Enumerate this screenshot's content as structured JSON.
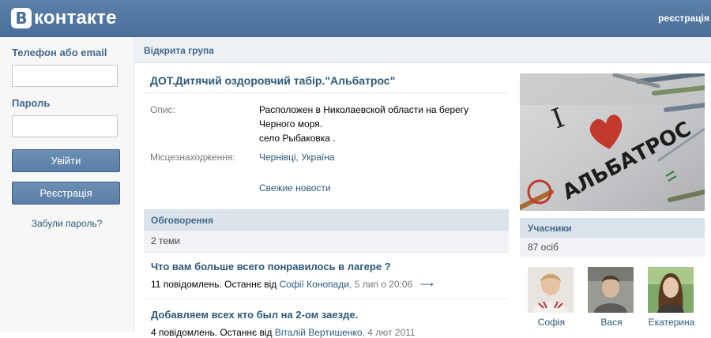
{
  "header": {
    "logo_letter": "B",
    "logo_text": "контакте",
    "register_link": "реєстрація"
  },
  "login": {
    "phone_label": "Телефон або email",
    "password_label": "Пароль",
    "login_button": "Увійти",
    "register_button": "Реєстрація",
    "forgot_link": "Забули пароль?"
  },
  "group": {
    "type_bar": "Відкрита група",
    "title": "ДОТ.Дитячий оздоровчий табір.\"Альбатрос\"",
    "description_label": "Опис:",
    "description_lines": [
      "Расположен в Николаевской области на берегу",
      "Черного моря.",
      "село Рыбаковка ."
    ],
    "location_label": "Місцезнаходження:",
    "location_value": "Чернівці, Україна",
    "news_link": "Свежие новости"
  },
  "discussions": {
    "header": "Обговорення",
    "count": "2 теми",
    "topics": [
      {
        "title": "Что вам больше всего понравилось в лагере ?",
        "meta_prefix": "11 повідомлень. Останнє від",
        "author": "Софії Конопади",
        "date": ", 5 лип о 20:06",
        "arrow": "⟶"
      },
      {
        "title": "Добавляем всех кто был на 2-ом заезде.",
        "meta_prefix": "4 повідомлень. Останнє від",
        "author": "Віталій Вертишенко",
        "date": ", 4 лют 2011",
        "arrow": "⟶"
      }
    ]
  },
  "members": {
    "header": "Учасники",
    "count": "87 осіб",
    "list": [
      {
        "name": "Софія"
      },
      {
        "name": "Вася"
      },
      {
        "name": "Екатерина"
      }
    ]
  },
  "photo": {
    "text_i": "I",
    "text_name": "АЛЬБАТРОС"
  },
  "colors": {
    "header_bg": "#4a6f9a",
    "link": "#2b587a",
    "section_head": "#dae2ea",
    "button": "#5a7fa8"
  }
}
